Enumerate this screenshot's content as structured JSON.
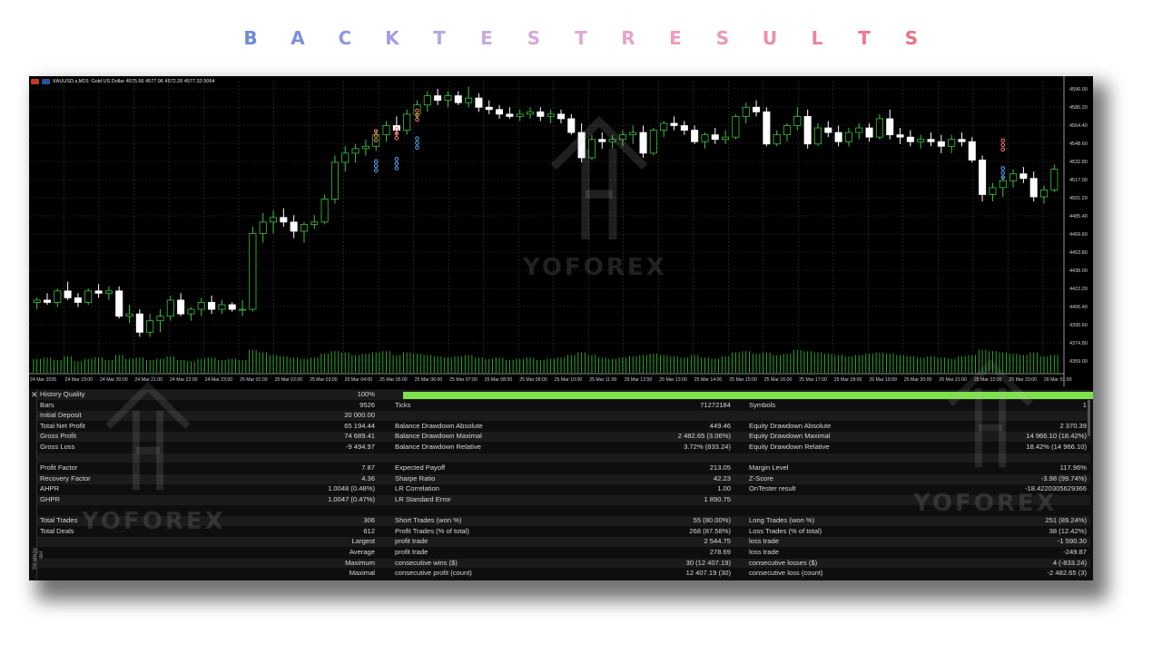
{
  "heading": {
    "letters": [
      "B",
      "A",
      "C",
      "K",
      "T",
      "E",
      "S",
      "T",
      "R",
      "E",
      "S",
      "U",
      "L",
      "T",
      "S"
    ],
    "colors": [
      "#6e8bd9",
      "#7d90db",
      "#8f97de",
      "#a39fe0",
      "#b6a6e2",
      "#c6a9e0",
      "#d5abdc",
      "#e0a9d5",
      "#e7a4cb",
      "#ec9ec0",
      "#ef96b4",
      "#f08ca7",
      "#f0829b",
      "#ef788f",
      "#ed6f84"
    ]
  },
  "chart": {
    "symbol": "XAUUSD.s,M15:  Gold US Dollar  4575.66 4577.96 4572.26 4577.33  5064",
    "watermark": "YOFOREX",
    "price_labels": [
      "4596.00",
      "4580.20",
      "4564.40",
      "4548.60",
      "4532.80",
      "4517.00",
      "4501.20",
      "4485.40",
      "4469.60",
      "4453.80",
      "4438.00",
      "4422.20",
      "4406.40",
      "4390.60",
      "4374.80",
      "4359.00"
    ],
    "time_labels": [
      "24 Mar 2026",
      "24 Mar 19:00",
      "24 Mar 20:00",
      "24 Mar 21:00",
      "24 Mar 22:00",
      "24 Mar 23:00",
      "25 Mar 01:00",
      "25 Mar 02:00",
      "25 Mar 03:00",
      "25 Mar 04:00",
      "25 Mar 05:00",
      "25 Mar 06:00",
      "25 Mar 07:00",
      "25 Mar 08:00",
      "25 Mar 09:00",
      "25 Mar 10:00",
      "25 Mar 11:00",
      "25 Mar 12:00",
      "25 Mar 13:00",
      "25 Mar 14:00",
      "25 Mar 15:00",
      "25 Mar 16:00",
      "25 Mar 17:00",
      "25 Mar 18:00",
      "25 Mar 19:00",
      "25 Mar 20:00",
      "25 Mar 21:00",
      "25 Mar 22:00",
      "25 Mar 23:00",
      "26 Mar 01:00"
    ],
    "colors": {
      "bull": "#39c43a",
      "bear": "#ffffff",
      "grid": "#3a3a3a",
      "volume": "#2fb52f",
      "axis_text": "#d0d0d0"
    },
    "candles": [
      [
        4410,
        4414,
        4404,
        4412
      ],
      [
        4412,
        4418,
        4408,
        4410
      ],
      [
        4410,
        4422,
        4406,
        4420
      ],
      [
        4420,
        4428,
        4412,
        4414
      ],
      [
        4414,
        4418,
        4406,
        4410
      ],
      [
        4410,
        4422,
        4408,
        4420
      ],
      [
        4420,
        4426,
        4414,
        4418
      ],
      [
        4418,
        4424,
        4412,
        4420
      ],
      [
        4420,
        4424,
        4396,
        4398
      ],
      [
        4398,
        4408,
        4392,
        4400
      ],
      [
        4400,
        4404,
        4380,
        4384
      ],
      [
        4384,
        4400,
        4380,
        4394
      ],
      [
        4394,
        4404,
        4384,
        4398
      ],
      [
        4398,
        4416,
        4394,
        4412
      ],
      [
        4412,
        4418,
        4398,
        4400
      ],
      [
        4400,
        4406,
        4394,
        4404
      ],
      [
        4404,
        4414,
        4398,
        4410
      ],
      [
        4410,
        4416,
        4400,
        4404
      ],
      [
        4404,
        4412,
        4400,
        4408
      ],
      [
        4408,
        4410,
        4402,
        4404
      ],
      [
        4404,
        4412,
        4398,
        4404
      ],
      [
        4404,
        4476,
        4402,
        4470
      ],
      [
        4470,
        4488,
        4462,
        4480
      ],
      [
        4480,
        4490,
        4470,
        4484
      ],
      [
        4484,
        4492,
        4476,
        4480
      ],
      [
        4480,
        4486,
        4466,
        4472
      ],
      [
        4472,
        4480,
        4462,
        4478
      ],
      [
        4478,
        4486,
        4474,
        4480
      ],
      [
        4480,
        4504,
        4478,
        4500
      ],
      [
        4500,
        4538,
        4496,
        4532
      ],
      [
        4532,
        4546,
        4524,
        4540
      ],
      [
        4540,
        4548,
        4532,
        4544
      ],
      [
        4544,
        4552,
        4538,
        4546
      ],
      [
        4546,
        4560,
        4542,
        4556
      ],
      [
        4556,
        4568,
        4550,
        4564
      ],
      [
        4564,
        4572,
        4556,
        4560
      ],
      [
        4560,
        4578,
        4556,
        4574
      ],
      [
        4574,
        4586,
        4570,
        4582
      ],
      [
        4582,
        4594,
        4576,
        4590
      ],
      [
        4590,
        4596,
        4582,
        4586
      ],
      [
        4586,
        4594,
        4580,
        4590
      ],
      [
        4590,
        4594,
        4582,
        4584
      ],
      [
        4584,
        4598,
        4580,
        4588
      ],
      [
        4588,
        4592,
        4576,
        4580
      ],
      [
        4580,
        4586,
        4574,
        4578
      ],
      [
        4578,
        4582,
        4570,
        4574
      ],
      [
        4574,
        4580,
        4570,
        4572
      ],
      [
        4572,
        4578,
        4568,
        4574
      ],
      [
        4574,
        4580,
        4570,
        4576
      ],
      [
        4576,
        4580,
        4568,
        4572
      ],
      [
        4572,
        4578,
        4566,
        4574
      ],
      [
        4574,
        4578,
        4566,
        4570
      ],
      [
        4570,
        4574,
        4556,
        4558
      ],
      [
        4558,
        4566,
        4532,
        4536
      ],
      [
        4536,
        4556,
        4534,
        4552
      ],
      [
        4552,
        4558,
        4544,
        4550
      ],
      [
        4550,
        4556,
        4544,
        4552
      ],
      [
        4552,
        4560,
        4546,
        4556
      ],
      [
        4556,
        4564,
        4548,
        4558
      ],
      [
        4558,
        4564,
        4536,
        4540
      ],
      [
        4540,
        4562,
        4538,
        4560
      ],
      [
        4560,
        4568,
        4554,
        4566
      ],
      [
        4566,
        4572,
        4560,
        4564
      ],
      [
        4564,
        4568,
        4556,
        4560
      ],
      [
        4560,
        4564,
        4548,
        4550
      ],
      [
        4550,
        4558,
        4544,
        4556
      ],
      [
        4556,
        4562,
        4548,
        4552
      ],
      [
        4552,
        4560,
        4548,
        4554
      ],
      [
        4554,
        4574,
        4552,
        4572
      ],
      [
        4572,
        4584,
        4566,
        4580
      ],
      [
        4580,
        4586,
        4572,
        4576
      ],
      [
        4576,
        4580,
        4546,
        4548
      ],
      [
        4548,
        4560,
        4546,
        4556
      ],
      [
        4556,
        4566,
        4550,
        4564
      ],
      [
        4564,
        4580,
        4560,
        4572
      ],
      [
        4572,
        4578,
        4544,
        4548
      ],
      [
        4548,
        4566,
        4546,
        4562
      ],
      [
        4562,
        4568,
        4554,
        4558
      ],
      [
        4558,
        4564,
        4546,
        4550
      ],
      [
        4550,
        4562,
        4546,
        4558
      ],
      [
        4558,
        4566,
        4552,
        4562
      ],
      [
        4562,
        4566,
        4550,
        4554
      ],
      [
        4554,
        4574,
        4552,
        4570
      ],
      [
        4570,
        4578,
        4552,
        4556
      ],
      [
        4556,
        4562,
        4548,
        4554
      ],
      [
        4554,
        4560,
        4546,
        4550
      ],
      [
        4550,
        4556,
        4544,
        4552
      ],
      [
        4552,
        4558,
        4546,
        4550
      ],
      [
        4550,
        4556,
        4540,
        4546
      ],
      [
        4546,
        4556,
        4540,
        4552
      ],
      [
        4552,
        4558,
        4546,
        4550
      ],
      [
        4550,
        4554,
        4532,
        4534
      ],
      [
        4534,
        4538,
        4498,
        4504
      ],
      [
        4504,
        4514,
        4498,
        4510
      ],
      [
        4510,
        4520,
        4502,
        4516
      ],
      [
        4516,
        4526,
        4510,
        4522
      ],
      [
        4522,
        4528,
        4514,
        4518
      ],
      [
        4518,
        4524,
        4498,
        4502
      ],
      [
        4502,
        4512,
        4496,
        4508
      ],
      [
        4508,
        4530,
        4506,
        4526
      ]
    ],
    "volumes": [
      0.55,
      0.6,
      0.5,
      0.65,
      0.45,
      0.55,
      0.6,
      0.5,
      0.7,
      0.55,
      0.6,
      0.5,
      0.55,
      0.65,
      0.5,
      0.45,
      0.55,
      0.6,
      0.5,
      0.55,
      0.5,
      0.9,
      0.8,
      0.7,
      0.65,
      0.6,
      0.55,
      0.6,
      0.75,
      0.85,
      0.8,
      0.7,
      0.75,
      0.8,
      0.85,
      0.7,
      0.8,
      0.75,
      0.7,
      0.65,
      0.6,
      0.65,
      0.7,
      0.6,
      0.55,
      0.6,
      0.5,
      0.55,
      0.6,
      0.5,
      0.55,
      0.6,
      0.7,
      0.8,
      0.7,
      0.6,
      0.55,
      0.6,
      0.65,
      0.7,
      0.75,
      0.7,
      0.65,
      0.6,
      0.7,
      0.6,
      0.55,
      0.65,
      0.8,
      0.85,
      0.75,
      0.8,
      0.7,
      0.75,
      0.9,
      0.85,
      0.8,
      0.75,
      0.7,
      0.65,
      0.7,
      0.75,
      0.8,
      0.75,
      0.7,
      0.65,
      0.6,
      0.65,
      0.6,
      0.55,
      0.65,
      0.7,
      0.9,
      0.85,
      0.8,
      0.75,
      0.7,
      0.8,
      0.65,
      0.7
    ],
    "trade_markers": [
      {
        "i": 33,
        "p": 4548,
        "side": "down"
      },
      {
        "i": 35,
        "p": 4550,
        "side": "down"
      },
      {
        "i": 37,
        "p": 4566,
        "side": "down"
      },
      {
        "i": 94,
        "p": 4540,
        "side": "down"
      },
      {
        "i": 33,
        "p": 4536,
        "side": "up"
      },
      {
        "i": 35,
        "p": 4538,
        "side": "up"
      },
      {
        "i": 37,
        "p": 4556,
        "side": "up"
      },
      {
        "i": 94,
        "p": 4530,
        "side": "up"
      }
    ]
  },
  "panel": {
    "vertical_label": "Strategy Tester",
    "rows": [
      {
        "c1": "History Quality",
        "v1": "100%",
        "c2": "",
        "v2": "",
        "c3": "",
        "v3": "",
        "bar": true
      },
      {
        "c1": "Bars",
        "v1": "9526",
        "c2": "Ticks",
        "v2": "71272184",
        "c3": "Symbols",
        "v3": "1"
      },
      {
        "c1": "Initial Deposit",
        "v1": "20 000.00",
        "c2": "",
        "v2": "",
        "c3": "",
        "v3": ""
      },
      {
        "c1": "Total Net Profit",
        "v1": "65 194.44",
        "c2": "Balance Drawdown Absolute",
        "v2": "449.46",
        "c3": "Equity Drawdown Absolute",
        "v3": "2 370.39"
      },
      {
        "c1": "Gross Profit",
        "v1": "74 689.41",
        "c2": "Balance Drawdown Maximal",
        "v2": "2 482.65 (3.06%)",
        "c3": "Equity Drawdown Maximal",
        "v3": "14 966.10 (18.42%)"
      },
      {
        "c1": "Gross Loss",
        "v1": "-9 494.97",
        "c2": "Balance Drawdown Relative",
        "v2": "3.72% (833.24)",
        "c3": "Equity Drawdown Relative",
        "v3": "18.42% (14 966.10)"
      },
      {
        "c1": "",
        "v1": "",
        "c2": "",
        "v2": "",
        "c3": "",
        "v3": ""
      },
      {
        "c1": "Profit Factor",
        "v1": "7.87",
        "c2": "Expected Payoff",
        "v2": "213.05",
        "c3": "Margin Level",
        "v3": "117.96%"
      },
      {
        "c1": "Recovery Factor",
        "v1": "4.36",
        "c2": "Sharpe Ratio",
        "v2": "42.23",
        "c3": "Z-Score",
        "v3": "-3.98 (99.74%)"
      },
      {
        "c1": "AHPR",
        "v1": "1.0048 (0.48%)",
        "c2": "LR Correlation",
        "v2": "1.00",
        "c3": "OnTester result",
        "v3": "-18.4220305629366"
      },
      {
        "c1": "GHPR",
        "v1": "1.0047 (0.47%)",
        "c2": "LR Standard Error",
        "v2": "1 890.75",
        "c3": "",
        "v3": ""
      },
      {
        "c1": "",
        "v1": "",
        "c2": "",
        "v2": "",
        "c3": "",
        "v3": ""
      },
      {
        "c1": "Total Trades",
        "v1": "306",
        "c2": "Short Trades (won %)",
        "v2": "55 (80.00%)",
        "c3": "Long Trades (won %)",
        "v3": "251 (89.24%)"
      },
      {
        "c1": "Total Deals",
        "v1": "612",
        "c2": "Profit Trades (% of total)",
        "v2": "268 (87.58%)",
        "c3": "Loss Trades (% of total)",
        "v3": "38 (12.42%)"
      },
      {
        "c1": "",
        "v1": "Largest",
        "c2": "profit trade",
        "v2": "2 544.75",
        "c3": "loss trade",
        "v3": "-1 590.30"
      },
      {
        "c1": "",
        "v1": "Average",
        "c2": "profit trade",
        "v2": "278.69",
        "c3": "loss trade",
        "v3": "-249.87"
      },
      {
        "c1": "",
        "v1": "Maximum",
        "c2": "consecutive wins ($)",
        "v2": "30 (12 407.19)",
        "c3": "consecutive losses ($)",
        "v3": "4 (-833.24)"
      },
      {
        "c1": "",
        "v1": "Maximal",
        "c2": "consecutive profit (count)",
        "v2": "12 407.19 (30)",
        "c3": "consecutive loss (count)",
        "v3": "-2 482.65 (3)"
      }
    ]
  }
}
